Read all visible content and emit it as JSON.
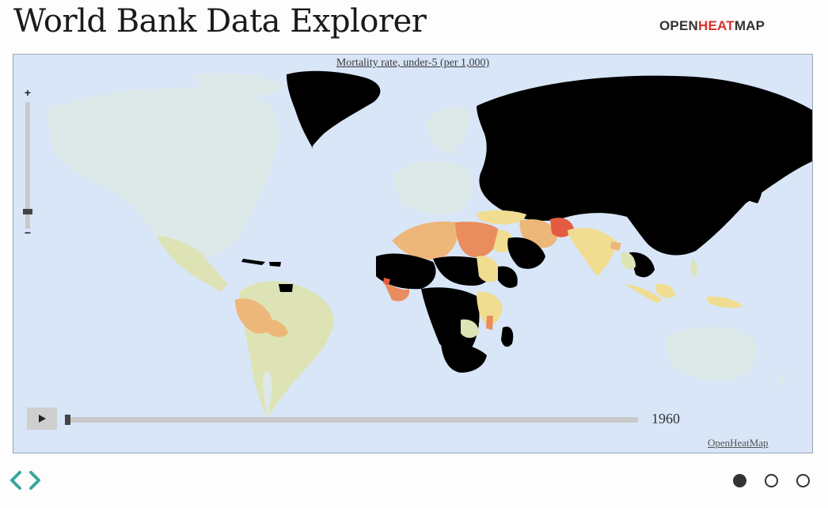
{
  "header": {
    "title": "World Bank Data Explorer"
  },
  "brand": {
    "part1": "OPEN",
    "part2": "HEAT",
    "part3": "MAP"
  },
  "colors": {
    "ocean": "#d8e6f8",
    "land_no_data": "#e3ebf0",
    "na_light": "#dde9e8",
    "level_low": "#dde3b4",
    "level_mid": "#f0dd92",
    "level_high": "#eeb77a",
    "level_very_high": "#e98d5e",
    "level_max": "#e35b40",
    "missing": "#000000",
    "brand_dark": "#333333",
    "brand_accent": "#d6312b",
    "nav_arrows": "#3aa79b"
  },
  "map": {
    "title": "Mortality rate, under-5 (per 1,000)",
    "credit": "OpenHeatMap",
    "zoom_in_label": "+",
    "zoom_out_label": "−",
    "year": "1960"
  },
  "controls": {
    "play_icon": "play-icon"
  },
  "pager": {
    "total": 3,
    "active": 1
  }
}
